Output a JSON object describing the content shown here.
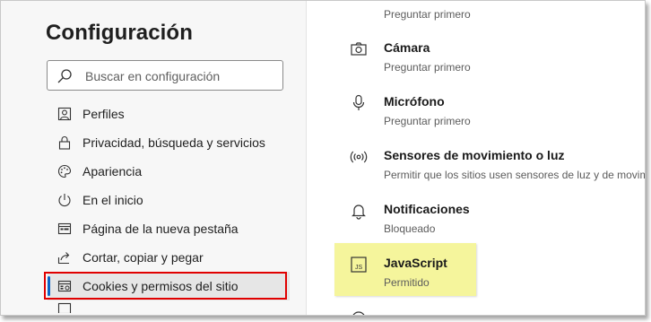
{
  "sidebar": {
    "title": "Configuración",
    "search_placeholder": "Buscar en configuración",
    "items": [
      {
        "label": "Perfiles",
        "icon": "profile-icon"
      },
      {
        "label": "Privacidad, búsqueda y servicios",
        "icon": "lock-icon"
      },
      {
        "label": "Apariencia",
        "icon": "palette-icon"
      },
      {
        "label": "En el inicio",
        "icon": "power-icon"
      },
      {
        "label": "Página de la nueva pestaña",
        "icon": "new-tab-icon"
      },
      {
        "label": "Cortar, copiar y pegar",
        "icon": "share-icon"
      },
      {
        "label": "Cookies y permisos del sitio",
        "icon": "cookies-permissions-icon",
        "active": true
      }
    ]
  },
  "content": {
    "top_partial_subtitle": "Preguntar primero",
    "permissions": [
      {
        "title": "Cámara",
        "subtitle": "Preguntar primero",
        "icon": "camera-icon"
      },
      {
        "title": "Micrófono",
        "subtitle": "Preguntar primero",
        "icon": "microphone-icon"
      },
      {
        "title": "Sensores de movimiento o luz",
        "subtitle": "Permitir que los sitios usen sensores de luz y de movim",
        "icon": "sensor-icon"
      },
      {
        "title": "Notificaciones",
        "subtitle": "Bloqueado",
        "icon": "bell-icon"
      },
      {
        "title": "JavaScript",
        "subtitle": "Permitido",
        "icon": "js-icon"
      }
    ]
  },
  "colors": {
    "accent": "#0b63c5",
    "highlight_box": "#e00000",
    "js_highlight": "#f5f59c"
  }
}
